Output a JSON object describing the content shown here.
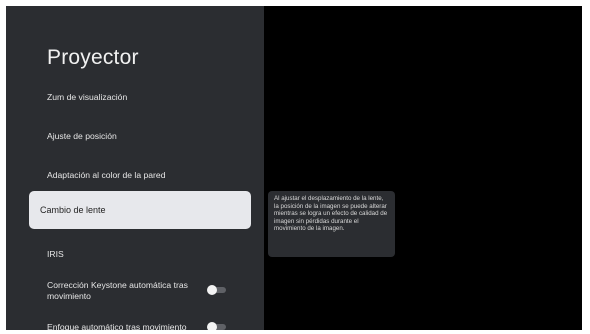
{
  "panel": {
    "title": "Proyector",
    "items": [
      {
        "label": "Zum de visualización"
      },
      {
        "label": "Ajuste de posición"
      },
      {
        "label": "Adaptación al color de la pared"
      },
      {
        "label": "Cambio de lente",
        "focused": true
      },
      {
        "label": "IRIS"
      },
      {
        "label_line1": "Corrección Keystone automática tras",
        "label_line2": "movimiento",
        "toggle": "off"
      },
      {
        "label": "Enfoque automático tras movimiento",
        "toggle": "off"
      }
    ]
  },
  "tooltip": {
    "text": "Al ajustar el desplazamiento de la lente, la posición de la imagen se puede alterar mientras se logra un efecto de calidad de imagen sin pérdidas durante el movimiento de la imagen."
  }
}
